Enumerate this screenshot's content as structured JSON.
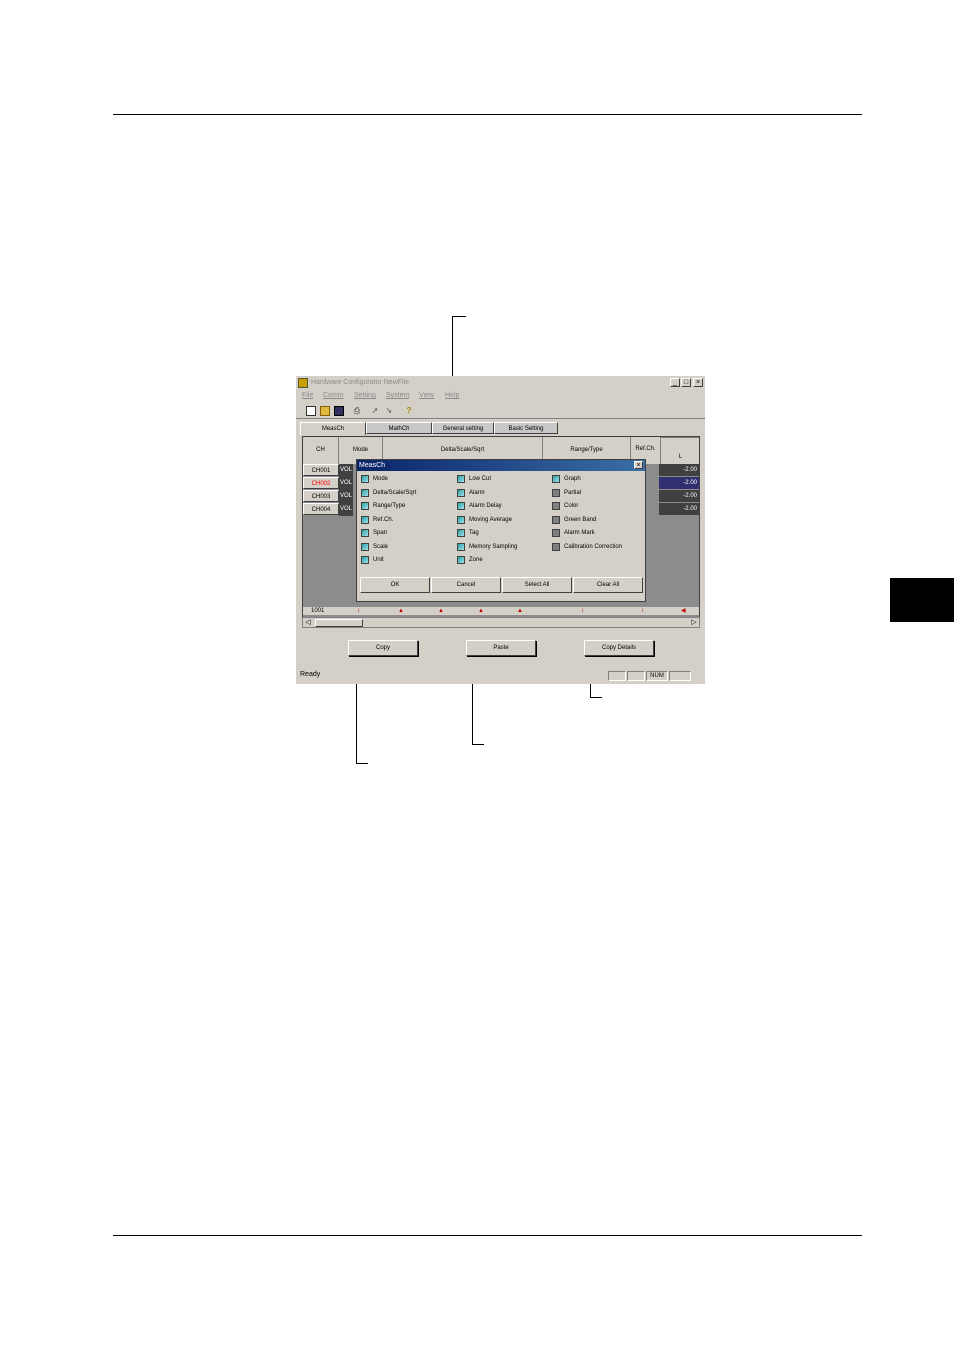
{
  "window": {
    "title": "Hardware Configurator NewFile",
    "controls": {
      "minimize": "_",
      "maximize": "□",
      "close": "×"
    },
    "menu": [
      "File",
      "Comm",
      "Setting",
      "System",
      "View",
      "Help"
    ],
    "tabs": [
      "MeasCh",
      "MathCh",
      "General setting",
      "Basic Setting"
    ],
    "active_tab": "MeasCh",
    "columns": [
      "CH",
      "Mode",
      "Delta/Scale/Sqrt",
      "Range/Type",
      "Ref.Ch.",
      "L"
    ],
    "rows": [
      {
        "ch": "CH001",
        "mode": "VOL",
        "value": "-2.00",
        "color": "#000000"
      },
      {
        "ch": "CH002",
        "mode": "VOL",
        "value": "-2.00",
        "color": "#ff0000"
      },
      {
        "ch": "CH003",
        "mode": "VOL",
        "value": "-2.00",
        "color": "#000000"
      },
      {
        "ch": "CH004",
        "mode": "VOL",
        "value": "-2.00",
        "color": "#000000"
      }
    ],
    "mark_row_label": "1001",
    "buttons": {
      "copy": "Copy",
      "paste": "Paste",
      "copy_details": "Copy Details"
    },
    "status": {
      "text": "Ready",
      "num": "NUM"
    }
  },
  "dialog": {
    "title": "MeasCh",
    "close": "×",
    "options": [
      {
        "label": "Mode",
        "checked": true
      },
      {
        "label": "Delta/Scale/Sqrt",
        "checked": true
      },
      {
        "label": "Range/Type",
        "checked": true
      },
      {
        "label": "Ref.Ch.",
        "checked": true
      },
      {
        "label": "Span",
        "checked": true
      },
      {
        "label": "Scale",
        "checked": true
      },
      {
        "label": "Unit",
        "checked": true
      },
      {
        "label": "Low Cut",
        "checked": true
      },
      {
        "label": "Alarm",
        "checked": true
      },
      {
        "label": "Alarm Delay",
        "checked": true
      },
      {
        "label": "Moving Average",
        "checked": true
      },
      {
        "label": "Tag",
        "checked": true
      },
      {
        "label": "Memory Sampling",
        "checked": true
      },
      {
        "label": "Zone",
        "checked": true
      },
      {
        "label": "Graph",
        "checked": true
      },
      {
        "label": "Partial",
        "checked": false
      },
      {
        "label": "Color",
        "checked": false
      },
      {
        "label": "Green Band",
        "checked": false
      },
      {
        "label": "Alarm Mark",
        "checked": false
      },
      {
        "label": "Calibration Correction",
        "checked": false
      }
    ],
    "buttons": {
      "ok": "OK",
      "cancel": "Cancel",
      "select_all": "Select All",
      "clear_all": "Clear All"
    }
  },
  "colors": {
    "accent": "#0a246a",
    "checked": "#2aa0a8",
    "window_bg": "#d4d0c8",
    "highlight_ch": "#ff0000"
  }
}
